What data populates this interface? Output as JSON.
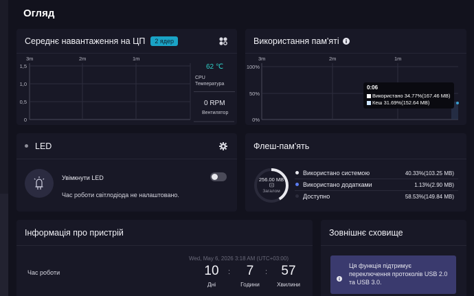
{
  "page_title": "Огляд",
  "cpu": {
    "title": "Середнє навантаження на ЦП",
    "badge": "2 ядер",
    "x_ticks": [
      "3m",
      "2m",
      "1m"
    ],
    "y_ticks": [
      "1,5",
      "1,0",
      "0,5",
      "0"
    ],
    "temperature_value": "62 ℃",
    "temperature_label_line1": "CPU",
    "temperature_label_line2": "Температура",
    "fan_value": "0 RPM",
    "fan_label": "Вентилятор"
  },
  "memory": {
    "title": "Використання пам'яті",
    "x_ticks": [
      "3m",
      "2m",
      "1m"
    ],
    "y_ticks": [
      "100%",
      "50%",
      "0%"
    ],
    "tooltip": {
      "time": "0:06",
      "used": "Використано 34.77%(167.46 MB)",
      "cache": "Кеш 31.69%(152.64 MB)"
    }
  },
  "led": {
    "title": "LED",
    "toggle_label": "Увімкнути LED",
    "toggle_state": "off",
    "note": "Час роботи світлодіода не налаштовано."
  },
  "flash": {
    "title": "Флеш-пам'ять",
    "total_value": "256.00 MB",
    "total_label": "Загалом",
    "rows": [
      {
        "label": "Використано системою",
        "value": "40.33%(103.25 MB)",
        "color": "#e8e8ee"
      },
      {
        "label": "Використано додатками",
        "value": "1.13%(2.90 MB)",
        "color": "#5b7cf0"
      },
      {
        "label": "Доступно",
        "value": "58.53%(149.84 MB)",
        "color": "#2c2c3c"
      }
    ],
    "used_fraction": 0.4146
  },
  "device": {
    "title": "Інформація про пристрій",
    "datetime": "Wed, May 6, 2026 3:18 AM (UTC+03:00)",
    "uptime_label": "Час роботи",
    "uptime": [
      {
        "value": "10",
        "unit": "Дні"
      },
      {
        "value": "7",
        "unit": "Години"
      },
      {
        "value": "57",
        "unit": "Хвилини"
      }
    ],
    "separator": ":"
  },
  "external": {
    "title": "Зовнішнє сховище",
    "notice": "Ця функція підтримує переключення протоколів USB 2.0 та USB 3.0."
  }
}
